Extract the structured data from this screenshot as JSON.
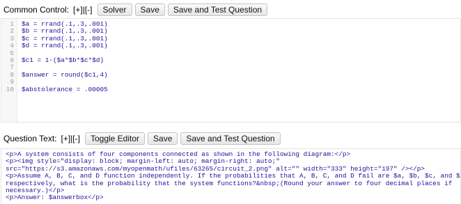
{
  "common_control": {
    "label": "Common Control:",
    "toggle": "[+]|[-]",
    "solver_label": "Solver",
    "save_label": "Save",
    "save_test_label": "Save and Test Question",
    "lines": [
      {
        "n": "1",
        "text": "$a = rrand(.1,.3,.001)"
      },
      {
        "n": "2",
        "text": "$b = rrand(.1,.3,.001)"
      },
      {
        "n": "3",
        "text": "$c = rrand(.1,.3,.001)"
      },
      {
        "n": "4",
        "text": "$d = rrand(.1,.3,.001)"
      },
      {
        "n": "5",
        "text": ""
      },
      {
        "n": "6",
        "text": "$c1 = 1-($a*$b*$c*$d)"
      },
      {
        "n": "7",
        "text": ""
      },
      {
        "n": "8",
        "text": "$answer = round($c1,4)"
      },
      {
        "n": "9",
        "text": ""
      },
      {
        "n": "10",
        "text": "$abstolerance = .00005"
      }
    ]
  },
  "question_text": {
    "label": "Question Text:",
    "toggle": "[+]|[-]",
    "toggle_editor_label": "Toggle Editor",
    "save_label": "Save",
    "save_test_label": "Save and Test Question",
    "lines": [
      "<p>A system consists of four components connected as shown in the following diagram:</p>",
      "<p><img style=\"display: block; margin-left: auto; margin-right: auto;\"",
      "src=\"https://s3.amazonaws.com/myopenmath/ufiles/63265/circuit_2.png\" alt=\"\" width=\"333\" height=\"197\" /></p>",
      "<p>Assume A, B, C, and D function independently. If the probabilities that A, B, C, and D fail are $a, $b, $c, and $d",
      "respectively, what is the probability that the system functions?&nbsp;(Round your answer to four decimal places if",
      "necessary.)</p>",
      "<p>Answer: $answerbox</p>"
    ]
  },
  "colors": {
    "code_text": "#221199",
    "tag": "#117700",
    "highlight": "#fff3a0",
    "line_number": "#999999"
  }
}
